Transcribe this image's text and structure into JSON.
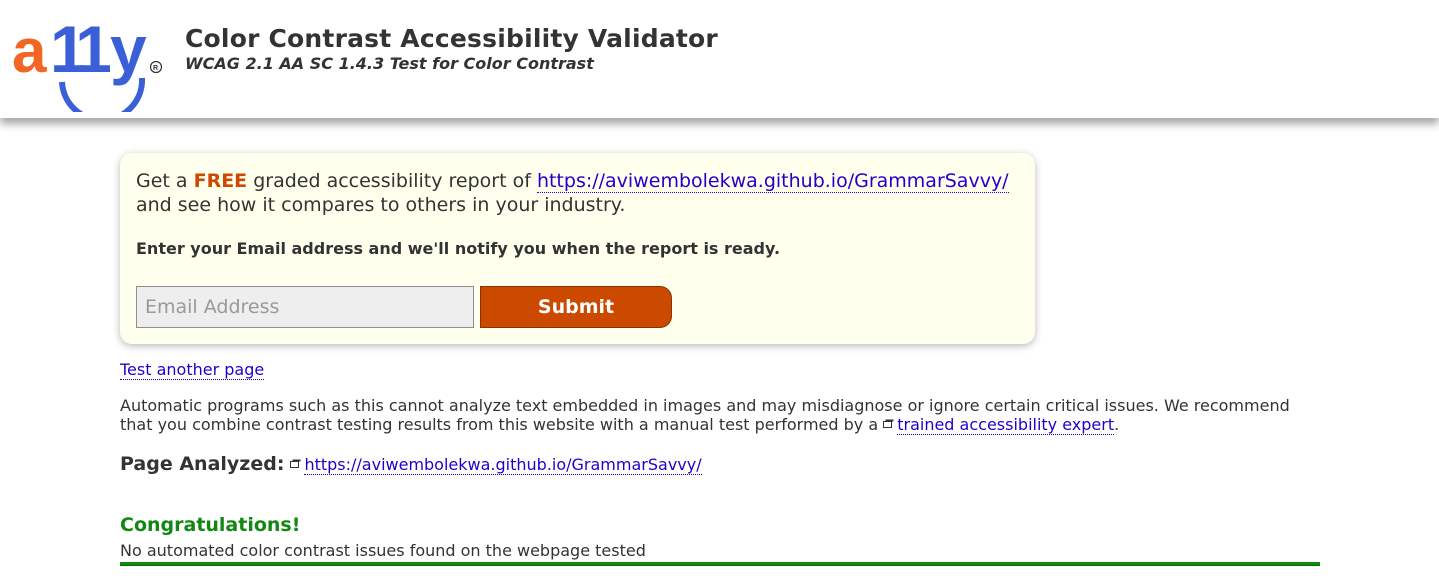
{
  "header": {
    "logo_text": "a11y",
    "title": "Color Contrast Accessibility Validator",
    "subtitle": "WCAG 2.1 AA SC 1.4.3 Test for Color Contrast"
  },
  "promo": {
    "intro_prefix": "Get a ",
    "free_word": "FREE",
    "intro_middle": " graded accessibility report of ",
    "report_url": "https://aviwembolekwa.github.io/GrammarSavvy/",
    "intro_suffix": "and see how it compares to others in your industry.",
    "instruction": "Enter your Email address and we'll notify you when the report is ready.",
    "email_placeholder": "Email Address",
    "submit_label": "Submit"
  },
  "main": {
    "test_another_link": "Test another page",
    "disclaimer_text": "Automatic programs such as this cannot analyze text embedded in images and may misdiagnose or ignore certain critical issues. We recommend that you combine contrast testing results from this website with a manual test performed by a ",
    "expert_link": "trained accessibility expert",
    "disclaimer_end": ".",
    "page_analyzed_label": "Page Analyzed:",
    "page_analyzed_url": "https://aviwembolekwa.github.io/GrammarSavvy/",
    "congrats_title": "Congratulations!",
    "congrats_text": "No automated color contrast issues found on the webpage tested"
  },
  "colors": {
    "logo_orange": "#f26522",
    "logo_blue": "#3b5fd6",
    "accent_orange": "#cc4a00",
    "link_blue": "#2200cc",
    "success_green": "#118811",
    "promo_background": "#ffffee"
  },
  "icons": {
    "external_link": "external-link-icon"
  }
}
